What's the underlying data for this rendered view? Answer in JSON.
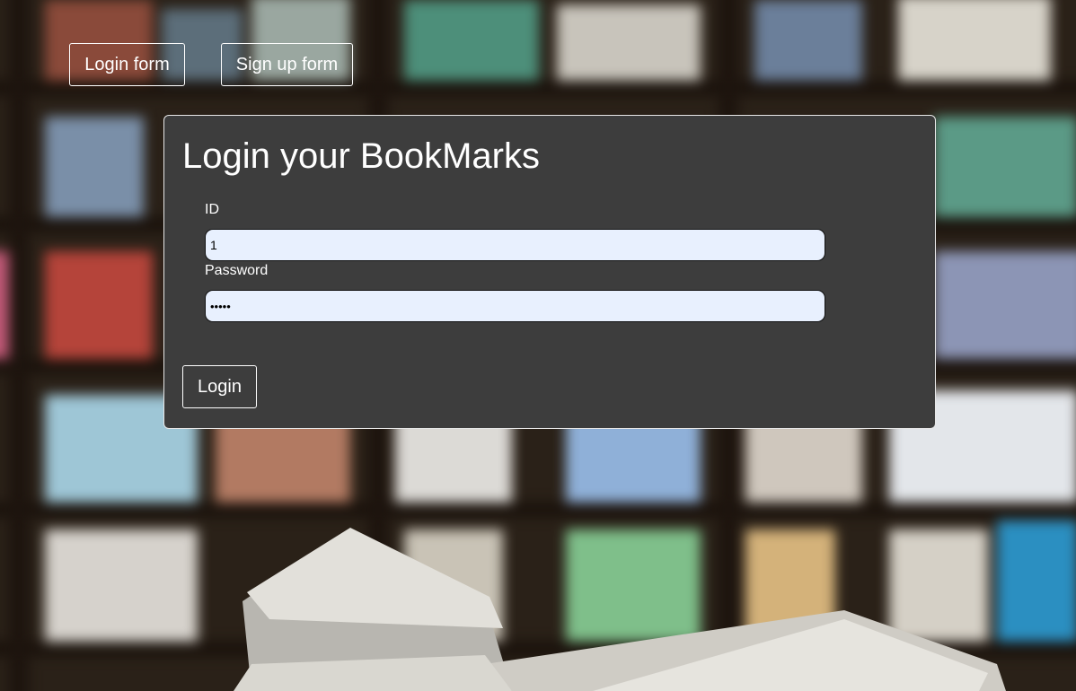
{
  "nav": {
    "login_form_label": "Login form",
    "signup_form_label": "Sign up form"
  },
  "login": {
    "title": "Login your BookMarks",
    "id_label": "ID",
    "id_value": "1",
    "password_label": "Password",
    "password_value": "•••••",
    "submit_label": "Login"
  },
  "colors": {
    "panel_background": "#3d3d3d",
    "input_background": "#e8f0fe",
    "text": "#ffffff"
  },
  "background": {
    "image": "blurred library bookshelves with an open book in the foreground"
  }
}
